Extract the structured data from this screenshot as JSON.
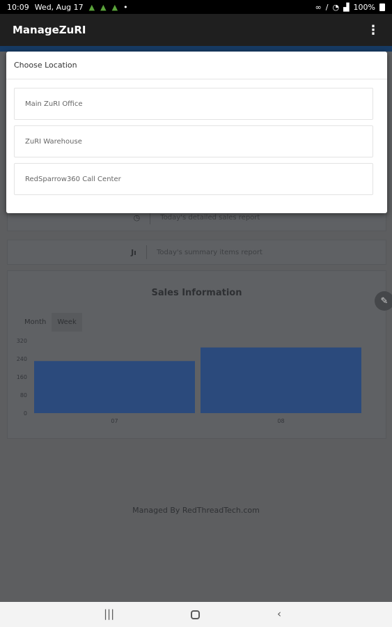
{
  "status_bar": {
    "time": "10:09",
    "date": "Wed, Aug 17",
    "notif_dot": "•",
    "battery": "100%"
  },
  "app_bar": {
    "title": "ManageZuRI",
    "menu_icon": "⋮"
  },
  "dialog": {
    "title": "Choose Location",
    "locations": [
      {
        "label": "Main ZuRI Office"
      },
      {
        "label": "ZuRI Warehouse"
      },
      {
        "label": "RedSparrow360 Call Center"
      }
    ]
  },
  "reports": {
    "detailed_label": "Today's detailed sales report",
    "summary_label": "Today's summary items report"
  },
  "sales": {
    "title": "Sales Information",
    "tabs": [
      {
        "label": "Month",
        "active": true
      },
      {
        "label": "Week",
        "active": false
      }
    ]
  },
  "chart_data": {
    "type": "bar",
    "categories": [
      "07",
      "08"
    ],
    "values": [
      230,
      290
    ],
    "yticks": [
      0,
      80,
      160,
      240,
      320
    ],
    "ylim": [
      0,
      320
    ],
    "color": "#2b4a7c",
    "title": "",
    "xlabel": "",
    "ylabel": ""
  },
  "footer": {
    "text": "Managed By RedThreadTech.com"
  },
  "colors": {
    "app_bar": "#1f1f1f",
    "accent_strip": "#163a63",
    "scrim_background": "#5d5e60"
  }
}
